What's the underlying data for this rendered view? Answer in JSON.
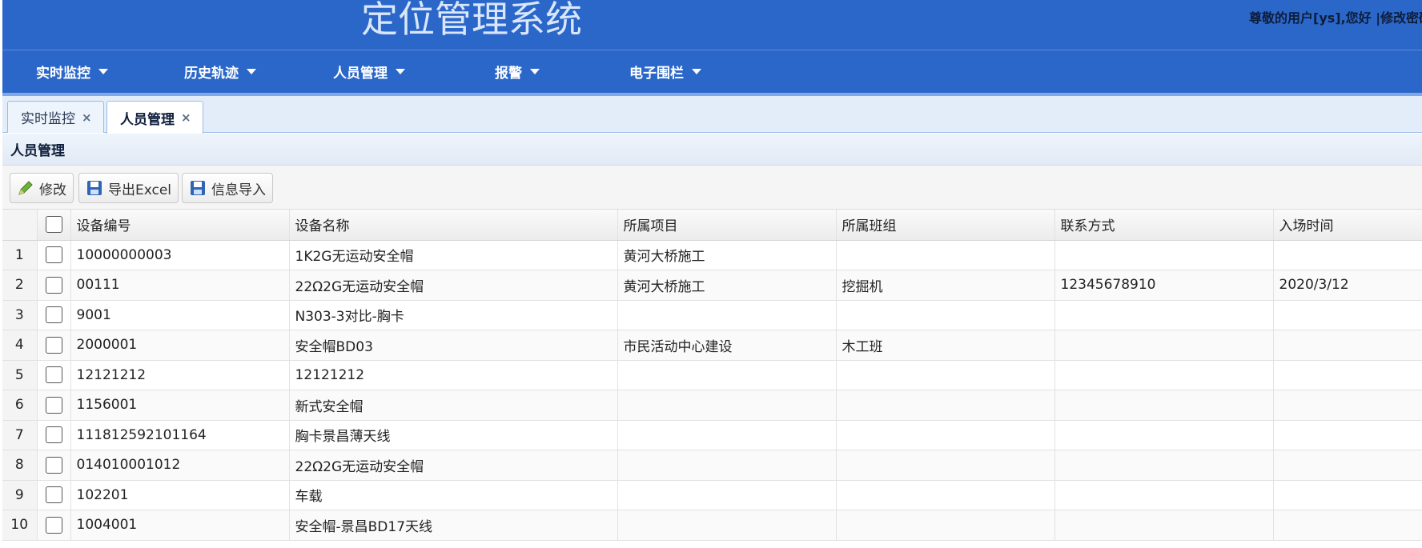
{
  "header": {
    "title": "定位管理系统",
    "user_info": "尊敬的用户[ys],您好 |修改密码"
  },
  "menu": [
    {
      "label": "实时监控"
    },
    {
      "label": "历史轨迹"
    },
    {
      "label": "人员管理"
    },
    {
      "label": "报警"
    },
    {
      "label": "电子围栏"
    }
  ],
  "tabs": [
    {
      "label": "实时监控",
      "close": "×",
      "active": false
    },
    {
      "label": "人员管理",
      "close": "×",
      "active": true
    }
  ],
  "panel": {
    "title": "人员管理"
  },
  "toolbar": {
    "edit_label": "修改",
    "export_label": "导出Excel",
    "import_label": "信息导入"
  },
  "table": {
    "columns": [
      "设备编号",
      "设备名称",
      "所属项目",
      "所属班组",
      "联系方式",
      "入场时间"
    ],
    "rows": [
      {
        "num": "1",
        "c": [
          "10000000003",
          "1K2G无运动安全帽",
          "黄河大桥施工",
          "",
          "",
          ""
        ]
      },
      {
        "num": "2",
        "c": [
          "00111",
          "22Ω2G无运动安全帽",
          "黄河大桥施工",
          "挖掘机",
          "12345678910",
          "2020/3/12"
        ]
      },
      {
        "num": "3",
        "c": [
          "9001",
          "N303-3对比-胸卡",
          "",
          "",
          "",
          ""
        ]
      },
      {
        "num": "4",
        "c": [
          "2000001",
          "安全帽BD03",
          "市民活动中心建设",
          "木工班",
          "",
          ""
        ]
      },
      {
        "num": "5",
        "c": [
          "12121212",
          "12121212",
          "",
          "",
          "",
          ""
        ]
      },
      {
        "num": "6",
        "c": [
          "1156001",
          "新式安全帽",
          "",
          "",
          "",
          ""
        ]
      },
      {
        "num": "7",
        "c": [
          "111812592101164",
          "胸卡景昌薄天线",
          "",
          "",
          "",
          ""
        ]
      },
      {
        "num": "8",
        "c": [
          "014010001012",
          "22Ω2G无运动安全帽",
          "",
          "",
          "",
          ""
        ]
      },
      {
        "num": "9",
        "c": [
          "102201",
          "车载",
          "",
          "",
          "",
          ""
        ]
      },
      {
        "num": "10",
        "c": [
          "1004001",
          "安全帽-景昌BD17天线",
          "",
          "",
          "",
          ""
        ]
      }
    ]
  },
  "colors": {
    "header_bg": "#2b67c9",
    "tab_bg": "#e3edf9"
  }
}
